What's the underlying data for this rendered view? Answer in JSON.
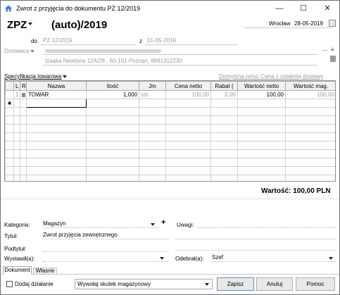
{
  "window": {
    "title": "Zwrot z przyjęcia do dokumentu PZ 12/2019",
    "controls": {
      "minimize": "—",
      "maximize": "☐",
      "close": "✕"
    }
  },
  "header": {
    "doc_type": "ZPZ",
    "doc_number": "(auto)/2019",
    "city": "Wrocław",
    "date": "28-05-2019",
    "do_label": "do",
    "do_value": "PZ 12/2019",
    "z_label": "z",
    "z_value": "01-05-2019",
    "supplier_label": "Dostawca",
    "supplier_address": "Izaaka Newtona 12A/28 , 60-161 Poznań, 8891312230"
  },
  "spec": {
    "label": "Specyfikacja towarowa",
    "default_price": "Domyślna cena: Cena z ostatniej dostawy",
    "columns": [
      "L",
      "R",
      "Nazwa",
      "Ilość",
      "Jm",
      "Cena netto",
      "Rabat (",
      "Wartość netto",
      "Wartość mag."
    ],
    "rows": [
      {
        "lp": "1",
        "name": "TOWAR",
        "qty": "1,000",
        "unit": "szt.",
        "price": "100,00",
        "discount": "0,00",
        "value": "100,00",
        "mag_value": "100,00"
      }
    ],
    "new_row_marker": "✱"
  },
  "total": {
    "label": "Wartość: 100,00 PLN"
  },
  "form": {
    "kategoria_label": "Kategoria:",
    "kategoria_value": "Magazyn",
    "tytul_label": "Tytuł:",
    "tytul_value": "Zwrot przyjęcia zewnętrznego",
    "podtytul_label": "Podtytuł:",
    "wystawil_label": "Wystawił(a):",
    "uwagi_label": "Uwagi:",
    "odebral_label": "Odebrał(a):",
    "odebral_value": "Szef"
  },
  "tabs": [
    "Dokument",
    "Własne"
  ],
  "footer": {
    "add_action": "Dodaj działanie",
    "effect_select": "Wywołaj skutek magazynowy",
    "save": "Zapisz",
    "cancel": "Anuluj",
    "help": "Pomoc"
  }
}
